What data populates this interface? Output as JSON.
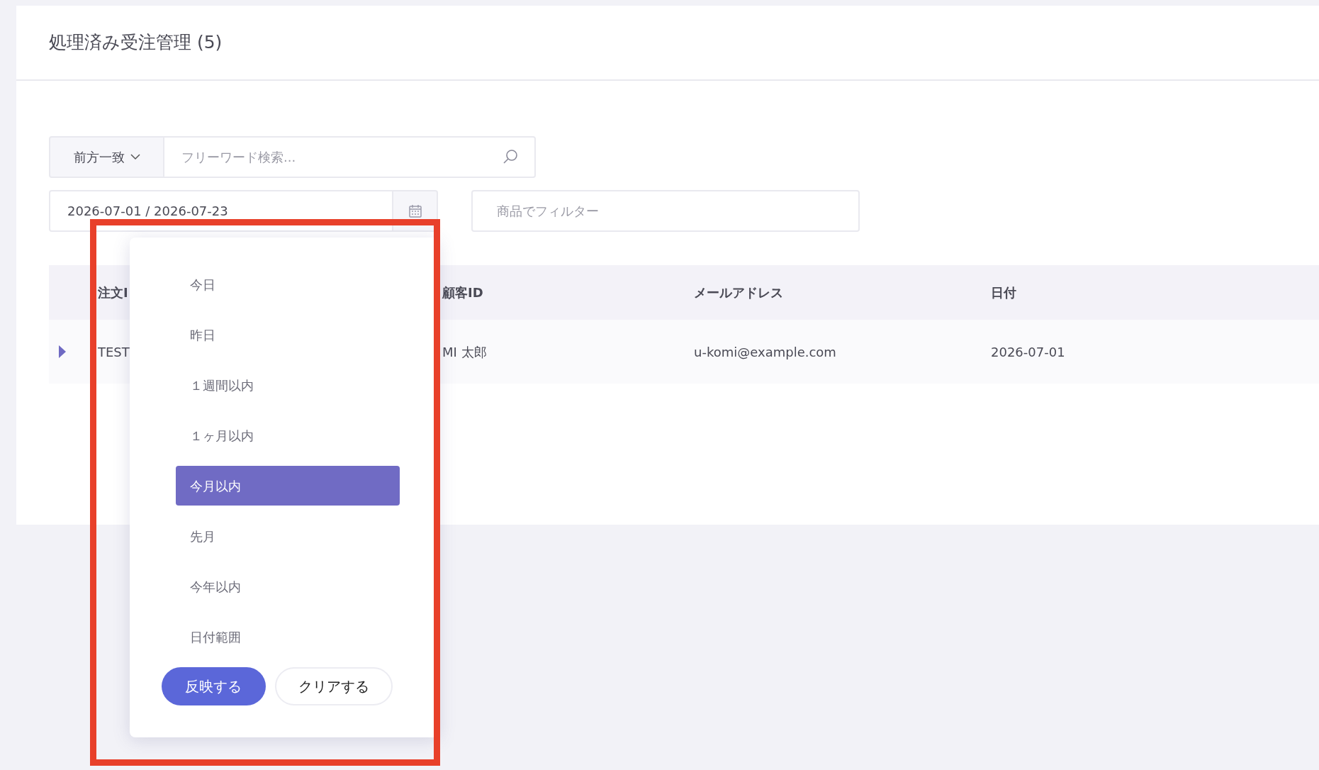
{
  "page": {
    "title": "処理済み受注管理 (5)"
  },
  "search": {
    "match_mode": "前方一致",
    "placeholder": "フリーワード検索..."
  },
  "date_range": {
    "value": "2026-07-01 / 2026-07-23"
  },
  "product_filter": {
    "placeholder": "商品でフィルター"
  },
  "table": {
    "columns": [
      "注文I",
      "顧客ID",
      "メールアドレス",
      "日付"
    ],
    "rows": [
      {
        "expanded": false,
        "cells": [
          "TEST",
          "MI 太郎",
          "u-komi@example.com",
          "2026-07-01"
        ]
      }
    ]
  },
  "date_menu": {
    "options": [
      {
        "label": "今日",
        "selected": false
      },
      {
        "label": "昨日",
        "selected": false
      },
      {
        "label": "１週間以内",
        "selected": false
      },
      {
        "label": "１ヶ月以内",
        "selected": false
      },
      {
        "label": "今月以内",
        "selected": true
      },
      {
        "label": "先月",
        "selected": false
      },
      {
        "label": "今年以内",
        "selected": false
      },
      {
        "label": "日付範囲",
        "selected": false
      }
    ],
    "buttons": [
      {
        "label": "反映する",
        "kind": "primary"
      },
      {
        "label": "クリアする",
        "kind": "secondary"
      }
    ]
  }
}
